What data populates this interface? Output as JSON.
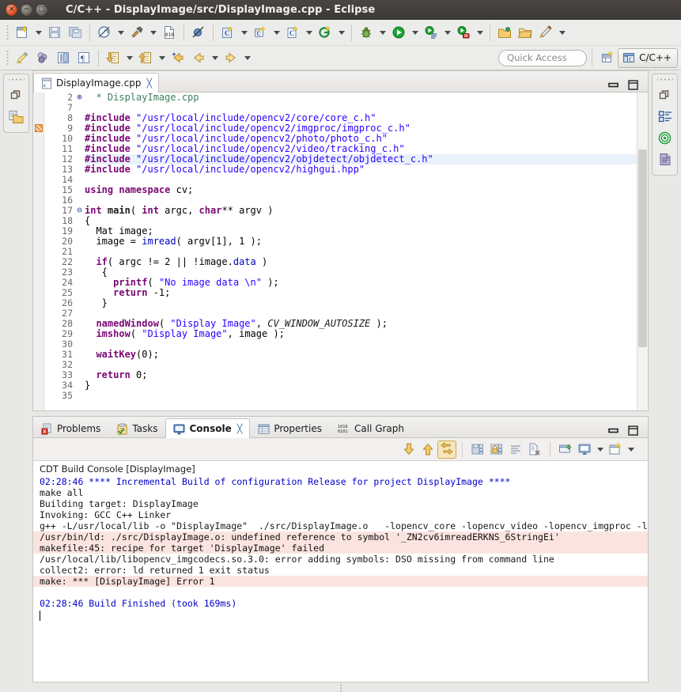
{
  "window": {
    "title": "C/C++ - DisplayImage/src/DisplayImage.cpp - Eclipse",
    "close_glyph": "×",
    "minimize_glyph": "−",
    "maximize_glyph": "□"
  },
  "toolbar1": [
    {
      "name": "new-button",
      "icon": "new-file-icon"
    },
    {
      "name": "new-dropdown",
      "icon": "chevron-down-icon"
    },
    {
      "name": "save-button",
      "icon": "save-icon"
    },
    {
      "name": "save-all-button",
      "icon": "save-all-icon"
    },
    {
      "name": "build-all-button",
      "icon": "build-all-icon"
    },
    {
      "name": "build-all-dropdown",
      "icon": "chevron-down-icon"
    },
    {
      "name": "build-button",
      "icon": "hammer-icon"
    },
    {
      "name": "build-dropdown",
      "icon": "chevron-down-icon"
    },
    {
      "name": "binary-button",
      "icon": "binary-file-icon"
    },
    {
      "name": "skip-breakpoints-button",
      "icon": "skip-breakpoints-icon"
    },
    {
      "name": "new-c-class-button",
      "icon": "new-class-icon"
    },
    {
      "name": "new-c-class-dropdown",
      "icon": "chevron-down-icon"
    },
    {
      "name": "new-c-project-button",
      "icon": "new-c-project-icon"
    },
    {
      "name": "new-c-project-dropdown",
      "icon": "chevron-down-icon"
    },
    {
      "name": "new-c-file-button",
      "icon": "new-c-file-icon"
    },
    {
      "name": "new-c-file-dropdown",
      "icon": "chevron-down-icon"
    },
    {
      "name": "open-element-button",
      "icon": "open-element-icon"
    },
    {
      "name": "open-element-dropdown",
      "icon": "chevron-down-icon"
    },
    {
      "name": "debug-button",
      "icon": "debug-bug-icon"
    },
    {
      "name": "debug-dropdown",
      "icon": "chevron-down-icon"
    },
    {
      "name": "run-button",
      "icon": "run-play-icon"
    },
    {
      "name": "run-dropdown",
      "icon": "chevron-down-icon"
    },
    {
      "name": "run-external-tools-button",
      "icon": "external-tools-icon"
    },
    {
      "name": "run-external-dropdown",
      "icon": "chevron-down-icon"
    },
    {
      "name": "profile-button",
      "icon": "profile-icon"
    },
    {
      "name": "profile-dropdown",
      "icon": "chevron-down-icon"
    },
    {
      "name": "new-folder-button",
      "icon": "folder-new-icon"
    },
    {
      "name": "open-folder-button",
      "icon": "folder-open-icon"
    },
    {
      "name": "edit-button",
      "icon": "pencil-icon"
    },
    {
      "name": "edit-dropdown",
      "icon": "chevron-down-icon"
    }
  ],
  "toolbar2": [
    {
      "name": "highlight-button",
      "icon": "marker-pen-icon"
    },
    {
      "name": "toggle-mark-occurrences-button",
      "icon": "occurrences-icon"
    },
    {
      "name": "toggle-block-selection-button",
      "icon": "block-selection-icon"
    },
    {
      "name": "show-whitespace-button",
      "icon": "pilcrow-icon"
    },
    {
      "name": "next-annotation-button",
      "icon": "next-annotation-icon"
    },
    {
      "name": "next-annotation-dropdown",
      "icon": "chevron-down-icon"
    },
    {
      "name": "previous-annotation-button",
      "icon": "previous-annotation-icon"
    },
    {
      "name": "previous-annotation-dropdown",
      "icon": "chevron-down-icon"
    },
    {
      "name": "last-edit-location-button",
      "icon": "last-edit-icon"
    },
    {
      "name": "back-button",
      "icon": "back-arrow-icon"
    },
    {
      "name": "back-dropdown",
      "icon": "chevron-down-icon"
    },
    {
      "name": "forward-button",
      "icon": "forward-arrow-icon"
    },
    {
      "name": "forward-dropdown",
      "icon": "chevron-down-icon"
    }
  ],
  "quick_access": {
    "placeholder": "Quick Access",
    "value": ""
  },
  "perspective": {
    "open_button_name": "open-perspective-button",
    "current": "C/C++"
  },
  "left_rail": {
    "icons": [
      "restore-icon",
      "project-explorer-icon"
    ]
  },
  "right_rail": {
    "icons": [
      "restore-icon",
      "outline-icon",
      "make-target-icon",
      "task-list-icon"
    ]
  },
  "editor": {
    "tabs": [
      {
        "label": "DisplayImage.cpp",
        "icon": "c-source-file-icon",
        "active": true,
        "closable": true
      }
    ],
    "minimize_label": "Minimize",
    "maximize_label": "Maximize",
    "scroll": {
      "thumb_top_pct": 18,
      "thumb_height_pct": 62
    },
    "lines": [
      {
        "num": "2",
        "fold": "⊕",
        "highlight": false,
        "marker": false,
        "tokens": [
          {
            "t": "  * DisplayImage.cpp",
            "c": "cmt"
          }
        ]
      },
      {
        "num": "7",
        "fold": "",
        "highlight": false,
        "marker": false,
        "tokens": []
      },
      {
        "num": "8",
        "fold": "",
        "highlight": false,
        "marker": false,
        "tokens": [
          {
            "t": "#include ",
            "c": "kw"
          },
          {
            "t": "\"/usr/local/include/opencv2/core/core_c.h\"",
            "c": "str"
          }
        ]
      },
      {
        "num": "9",
        "fold": "",
        "highlight": false,
        "marker": true,
        "tokens": [
          {
            "t": "#include ",
            "c": "kw"
          },
          {
            "t": "\"/usr/local/include/opencv2/imgproc/imgproc_c.h\"",
            "c": "str"
          }
        ]
      },
      {
        "num": "10",
        "fold": "",
        "highlight": false,
        "marker": false,
        "tokens": [
          {
            "t": "#include ",
            "c": "kw"
          },
          {
            "t": "\"/usr/local/include/opencv2/photo/photo_c.h\"",
            "c": "str"
          }
        ]
      },
      {
        "num": "11",
        "fold": "",
        "highlight": false,
        "marker": false,
        "tokens": [
          {
            "t": "#include ",
            "c": "kw"
          },
          {
            "t": "\"/usr/local/include/opencv2/video/tracking_c.h\"",
            "c": "str"
          }
        ]
      },
      {
        "num": "12",
        "fold": "",
        "highlight": true,
        "marker": false,
        "tokens": [
          {
            "t": "#include ",
            "c": "kw"
          },
          {
            "t": "\"/usr/local/include/opencv2/objdetect/objdetect_c.h\"",
            "c": "str"
          }
        ]
      },
      {
        "num": "13",
        "fold": "",
        "highlight": false,
        "marker": false,
        "tokens": [
          {
            "t": "#include ",
            "c": "kw"
          },
          {
            "t": "\"/usr/local/include/opencv2/highgui.hpp\"",
            "c": "str"
          }
        ]
      },
      {
        "num": "14",
        "fold": "",
        "highlight": false,
        "marker": false,
        "tokens": []
      },
      {
        "num": "15",
        "fold": "",
        "highlight": false,
        "marker": false,
        "tokens": [
          {
            "t": "using namespace ",
            "c": "kw"
          },
          {
            "t": "cv;",
            "c": "plain"
          }
        ]
      },
      {
        "num": "16",
        "fold": "",
        "highlight": false,
        "marker": false,
        "tokens": []
      },
      {
        "num": "17",
        "fold": "⊖",
        "highlight": false,
        "marker": false,
        "tokens": [
          {
            "t": "int ",
            "c": "kw"
          },
          {
            "t": "main",
            "c": "fn"
          },
          {
            "t": "( ",
            "c": "plain"
          },
          {
            "t": "int ",
            "c": "kw"
          },
          {
            "t": "argc, ",
            "c": "plain"
          },
          {
            "t": "char",
            "c": "kw"
          },
          {
            "t": "** argv )",
            "c": "plain"
          }
        ]
      },
      {
        "num": "18",
        "fold": "",
        "highlight": false,
        "marker": false,
        "tokens": [
          {
            "t": "{",
            "c": "plain"
          }
        ]
      },
      {
        "num": "19",
        "fold": "",
        "highlight": false,
        "marker": false,
        "tokens": [
          {
            "t": "  Mat image;",
            "c": "plain"
          }
        ]
      },
      {
        "num": "20",
        "fold": "",
        "highlight": false,
        "marker": false,
        "tokens": [
          {
            "t": "  image = ",
            "c": "plain"
          },
          {
            "t": "imread",
            "c": "field"
          },
          {
            "t": "( argv[1], 1 );",
            "c": "plain"
          }
        ]
      },
      {
        "num": "21",
        "fold": "",
        "highlight": false,
        "marker": false,
        "tokens": []
      },
      {
        "num": "22",
        "fold": "",
        "highlight": false,
        "marker": false,
        "tokens": [
          {
            "t": "  ",
            "c": "plain"
          },
          {
            "t": "if",
            "c": "kw"
          },
          {
            "t": "( argc != 2 || !image.",
            "c": "plain"
          },
          {
            "t": "data",
            "c": "field"
          },
          {
            "t": " )",
            "c": "plain"
          }
        ]
      },
      {
        "num": "23",
        "fold": "",
        "highlight": false,
        "marker": false,
        "tokens": [
          {
            "t": "   {",
            "c": "plain"
          }
        ]
      },
      {
        "num": "24",
        "fold": "",
        "highlight": false,
        "marker": false,
        "tokens": [
          {
            "t": "     ",
            "c": "plain"
          },
          {
            "t": "printf",
            "c": "kw"
          },
          {
            "t": "( ",
            "c": "plain"
          },
          {
            "t": "\"No image data \\n\"",
            "c": "str"
          },
          {
            "t": " );",
            "c": "plain"
          }
        ]
      },
      {
        "num": "25",
        "fold": "",
        "highlight": false,
        "marker": false,
        "tokens": [
          {
            "t": "     ",
            "c": "plain"
          },
          {
            "t": "return ",
            "c": "kw"
          },
          {
            "t": "-1;",
            "c": "plain"
          }
        ]
      },
      {
        "num": "26",
        "fold": "",
        "highlight": false,
        "marker": false,
        "tokens": [
          {
            "t": "   }",
            "c": "plain"
          }
        ]
      },
      {
        "num": "27",
        "fold": "",
        "highlight": false,
        "marker": false,
        "tokens": []
      },
      {
        "num": "28",
        "fold": "",
        "highlight": false,
        "marker": false,
        "tokens": [
          {
            "t": "  ",
            "c": "plain"
          },
          {
            "t": "namedWindow",
            "c": "kw"
          },
          {
            "t": "( ",
            "c": "plain"
          },
          {
            "t": "\"Display Image\"",
            "c": "str"
          },
          {
            "t": ", ",
            "c": "plain"
          },
          {
            "t": "CV_WINDOW_AUTOSIZE",
            "c": "stat"
          },
          {
            "t": " );",
            "c": "plain"
          }
        ]
      },
      {
        "num": "29",
        "fold": "",
        "highlight": false,
        "marker": false,
        "tokens": [
          {
            "t": "  ",
            "c": "plain"
          },
          {
            "t": "imshow",
            "c": "kw"
          },
          {
            "t": "( ",
            "c": "plain"
          },
          {
            "t": "\"Display Image\"",
            "c": "str"
          },
          {
            "t": ", image );",
            "c": "plain"
          }
        ]
      },
      {
        "num": "30",
        "fold": "",
        "highlight": false,
        "marker": false,
        "tokens": []
      },
      {
        "num": "31",
        "fold": "",
        "highlight": false,
        "marker": false,
        "tokens": [
          {
            "t": "  ",
            "c": "plain"
          },
          {
            "t": "waitKey",
            "c": "kw"
          },
          {
            "t": "(0);",
            "c": "plain"
          }
        ]
      },
      {
        "num": "32",
        "fold": "",
        "highlight": false,
        "marker": false,
        "tokens": []
      },
      {
        "num": "33",
        "fold": "",
        "highlight": false,
        "marker": false,
        "tokens": [
          {
            "t": "  ",
            "c": "plain"
          },
          {
            "t": "return ",
            "c": "kw"
          },
          {
            "t": "0;",
            "c": "plain"
          }
        ]
      },
      {
        "num": "34",
        "fold": "",
        "highlight": false,
        "marker": false,
        "tokens": [
          {
            "t": "}",
            "c": "plain"
          }
        ]
      },
      {
        "num": "35",
        "fold": "",
        "highlight": false,
        "marker": false,
        "tokens": []
      }
    ]
  },
  "console_view": {
    "tabs": [
      {
        "label": "Problems",
        "icon": "problems-icon",
        "active": false,
        "closable": false
      },
      {
        "label": "Tasks",
        "icon": "tasks-icon",
        "active": false,
        "closable": false
      },
      {
        "label": "Console",
        "icon": "console-icon",
        "active": true,
        "closable": true
      },
      {
        "label": "Properties",
        "icon": "properties-icon",
        "active": false,
        "closable": false
      },
      {
        "label": "Call Graph",
        "icon": "call-graph-icon",
        "active": false,
        "closable": false
      }
    ],
    "toolbar": [
      {
        "name": "scroll-to-bottom-button",
        "icon": "down-arrow-icon",
        "pressed": false
      },
      {
        "name": "scroll-to-top-button",
        "icon": "up-arrow-icon",
        "pressed": false
      },
      {
        "name": "scroll-lock-button",
        "icon": "scroll-lock-icon",
        "pressed": true
      },
      {
        "name": "save-console-button",
        "icon": "save-console-icon",
        "pressed": false
      },
      {
        "name": "pin-console-button",
        "icon": "lock-console-icon",
        "pressed": false
      },
      {
        "name": "clear-console-button",
        "icon": "clear-console-icon",
        "pressed": false
      },
      {
        "name": "remove-console-button",
        "icon": "remove-launch-icon",
        "pressed": false
      },
      {
        "name": "open-console-button",
        "icon": "open-console-icon",
        "pressed": false
      },
      {
        "name": "display-console-button",
        "icon": "display-console-icon",
        "pressed": false
      },
      {
        "name": "display-console-dropdown",
        "icon": "chevron-down-icon",
        "pressed": false
      },
      {
        "name": "new-console-view-button",
        "icon": "new-console-icon",
        "pressed": false
      },
      {
        "name": "new-console-view-dropdown",
        "icon": "chevron-down-icon",
        "pressed": false
      }
    ],
    "minimize_label": "Minimize",
    "maximize_label": "Maximize",
    "header": "CDT Build Console [DisplayImage]",
    "lines": [
      {
        "text": "02:28:46 **** Incremental Build of configuration Release for project DisplayImage ****",
        "style": "blue"
      },
      {
        "text": "make all",
        "style": "normal"
      },
      {
        "text": "Building target: DisplayImage",
        "style": "normal"
      },
      {
        "text": "Invoking: GCC C++ Linker",
        "style": "normal"
      },
      {
        "text": "g++ -L/usr/local/lib -o \"DisplayImage\"  ./src/DisplayImage.o   -lopencv_core -lopencv_video -lopencv_imgproc -lopencv_highgui",
        "style": "normal"
      },
      {
        "text": "/usr/bin/ld: ./src/DisplayImage.o: undefined reference to symbol '_ZN2cv6imreadERKNS_6StringEi'",
        "style": "error"
      },
      {
        "text": "makefile:45: recipe for target 'DisplayImage' failed",
        "style": "error"
      },
      {
        "text": "/usr/local/lib/libopencv_imgcodecs.so.3.0: error adding symbols: DSO missing from command line",
        "style": "normal"
      },
      {
        "text": "collect2: error: ld returned 1 exit status",
        "style": "normal"
      },
      {
        "text": "make: *** [DisplayImage] Error 1",
        "style": "error"
      },
      {
        "text": "",
        "style": "blank"
      },
      {
        "text": "02:28:46 Build Finished (took 169ms)",
        "style": "blue"
      }
    ]
  },
  "colors": {
    "titlebar_bg": "#3d3936",
    "keyword": "#7a0874",
    "string": "#2a00ff",
    "comment": "#3f7f5f",
    "field": "#0000c0",
    "console_blue": "#0000c8",
    "console_error_bg": "#fbe4e0",
    "highlight_line": "#e9f1fb",
    "accent_pressed": "#f7e6bd"
  }
}
